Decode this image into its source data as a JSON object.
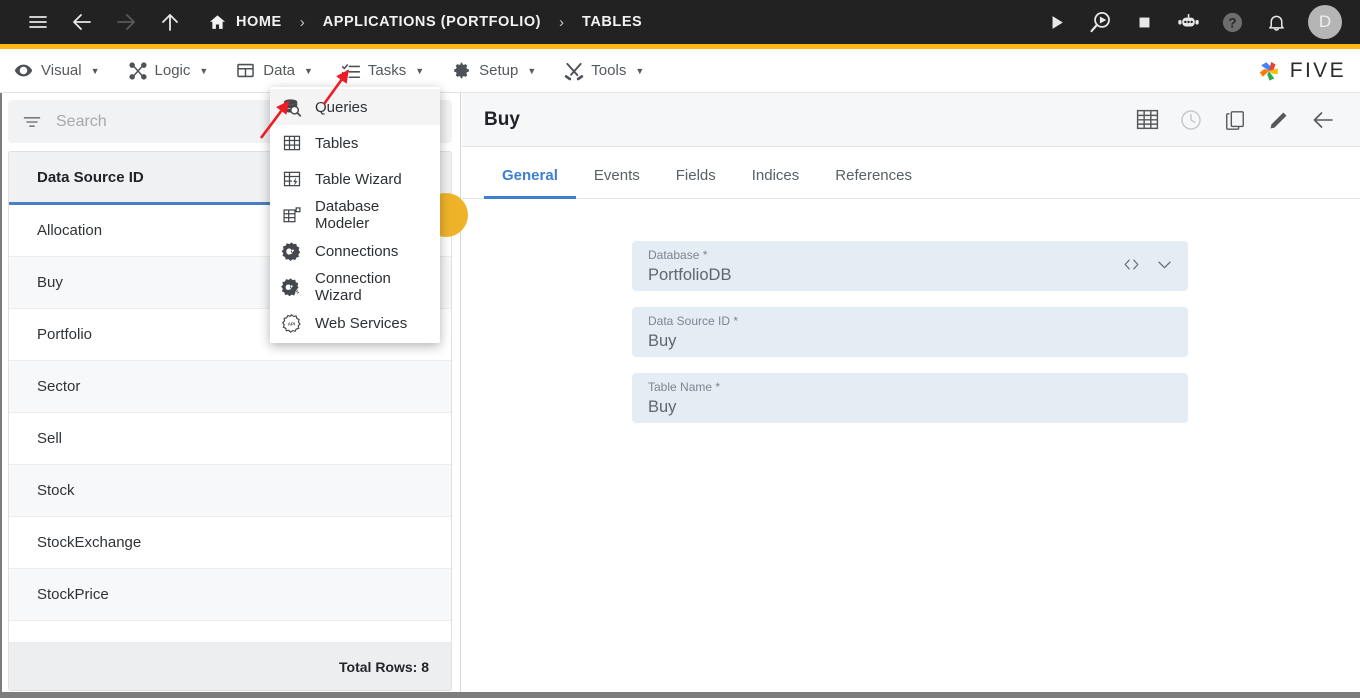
{
  "topbar": {
    "icons": [
      {
        "name": "hamburger-menu-icon",
        "label": "Menu"
      },
      {
        "name": "back-arrow-icon",
        "label": "Back"
      },
      {
        "name": "forward-arrow-icon",
        "label": "Forward"
      },
      {
        "name": "up-arrow-icon",
        "label": "Up"
      }
    ],
    "breadcrumb": [
      {
        "label": "HOME",
        "icon": "home-icon"
      },
      {
        "label": "APPLICATIONS (PORTFOLIO)",
        "icon": ""
      },
      {
        "label": "TABLES",
        "icon": ""
      }
    ],
    "separator": "›",
    "right_icons": [
      {
        "name": "run-play-icon"
      },
      {
        "name": "run-debug-icon"
      },
      {
        "name": "stop-icon"
      },
      {
        "name": "chatbot-icon"
      },
      {
        "name": "help-icon"
      },
      {
        "name": "notifications-bell-icon"
      }
    ],
    "avatar_initial": "D",
    "accent_color": "#fcb913"
  },
  "menubar": {
    "items": [
      {
        "label": "Visual",
        "icon": "eye-icon",
        "caret": "▼"
      },
      {
        "label": "Logic",
        "icon": "logic-nodes-icon",
        "caret": "▼"
      },
      {
        "label": "Data",
        "icon": "table-grid-icon",
        "caret": "▼"
      },
      {
        "label": "Tasks",
        "icon": "checklist-icon",
        "caret": "▼"
      },
      {
        "label": "Setup",
        "icon": "gear-icon",
        "caret": "▼"
      },
      {
        "label": "Tools",
        "icon": "tools-cross-icon",
        "caret": "▼"
      }
    ],
    "brand": "FIVE"
  },
  "dropdown": {
    "open_for": "Data",
    "items": [
      {
        "label": "Queries",
        "icon": "queries-db-search-icon",
        "hovered": true
      },
      {
        "label": "Tables",
        "icon": "table-grid-icon",
        "hovered": false
      },
      {
        "label": "Table Wizard",
        "icon": "table-wizard-icon",
        "hovered": false
      },
      {
        "label": "Database Modeler",
        "icon": "database-modeler-icon",
        "hovered": false
      },
      {
        "label": "Connections",
        "icon": "connections-icon",
        "hovered": false
      },
      {
        "label": "Connection Wizard",
        "icon": "connection-wizard-icon",
        "hovered": false
      },
      {
        "label": "Web Services",
        "icon": "web-services-api-icon",
        "hovered": false
      }
    ]
  },
  "annotations": {
    "arrow_color": "#ee1b24",
    "arrows": [
      {
        "name": "arrow-to-data-menu",
        "points_to": "Data"
      },
      {
        "name": "arrow-to-queries-item",
        "points_to": "Queries"
      }
    ]
  },
  "left_panel": {
    "search": {
      "placeholder": "Search",
      "value": "",
      "filter_icon": "filter-icon"
    },
    "add_button": {
      "name": "add-record-fab",
      "color": "#efb32a"
    },
    "grid": {
      "column_header": "Data Source ID",
      "rows": [
        "Allocation",
        "Buy",
        "Portfolio",
        "Sector",
        "Sell",
        "Stock",
        "StockExchange",
        "StockPrice"
      ],
      "footer": "Total Rows: 8",
      "header_underline_color": "#4a7fc1"
    }
  },
  "right_panel": {
    "title": "Buy",
    "actions": [
      {
        "name": "table-view-icon",
        "dim": false
      },
      {
        "name": "history-clock-icon",
        "dim": true
      },
      {
        "name": "duplicate-copy-icon",
        "dim": false
      },
      {
        "name": "edit-pencil-icon",
        "dim": false
      },
      {
        "name": "back-arrow-icon",
        "dim": false
      }
    ],
    "tabs": [
      {
        "label": "General",
        "active": true
      },
      {
        "label": "Events",
        "active": false
      },
      {
        "label": "Fields",
        "active": false
      },
      {
        "label": "Indices",
        "active": false
      },
      {
        "label": "References",
        "active": false
      }
    ],
    "fields": [
      {
        "label": "Database *",
        "value": "PortfolioDB",
        "icons": [
          "code-brackets-icon",
          "chevron-down-icon"
        ]
      },
      {
        "label": "Data Source ID *",
        "value": "Buy",
        "icons": []
      },
      {
        "label": "Table Name *",
        "value": "Buy",
        "icons": []
      }
    ]
  }
}
